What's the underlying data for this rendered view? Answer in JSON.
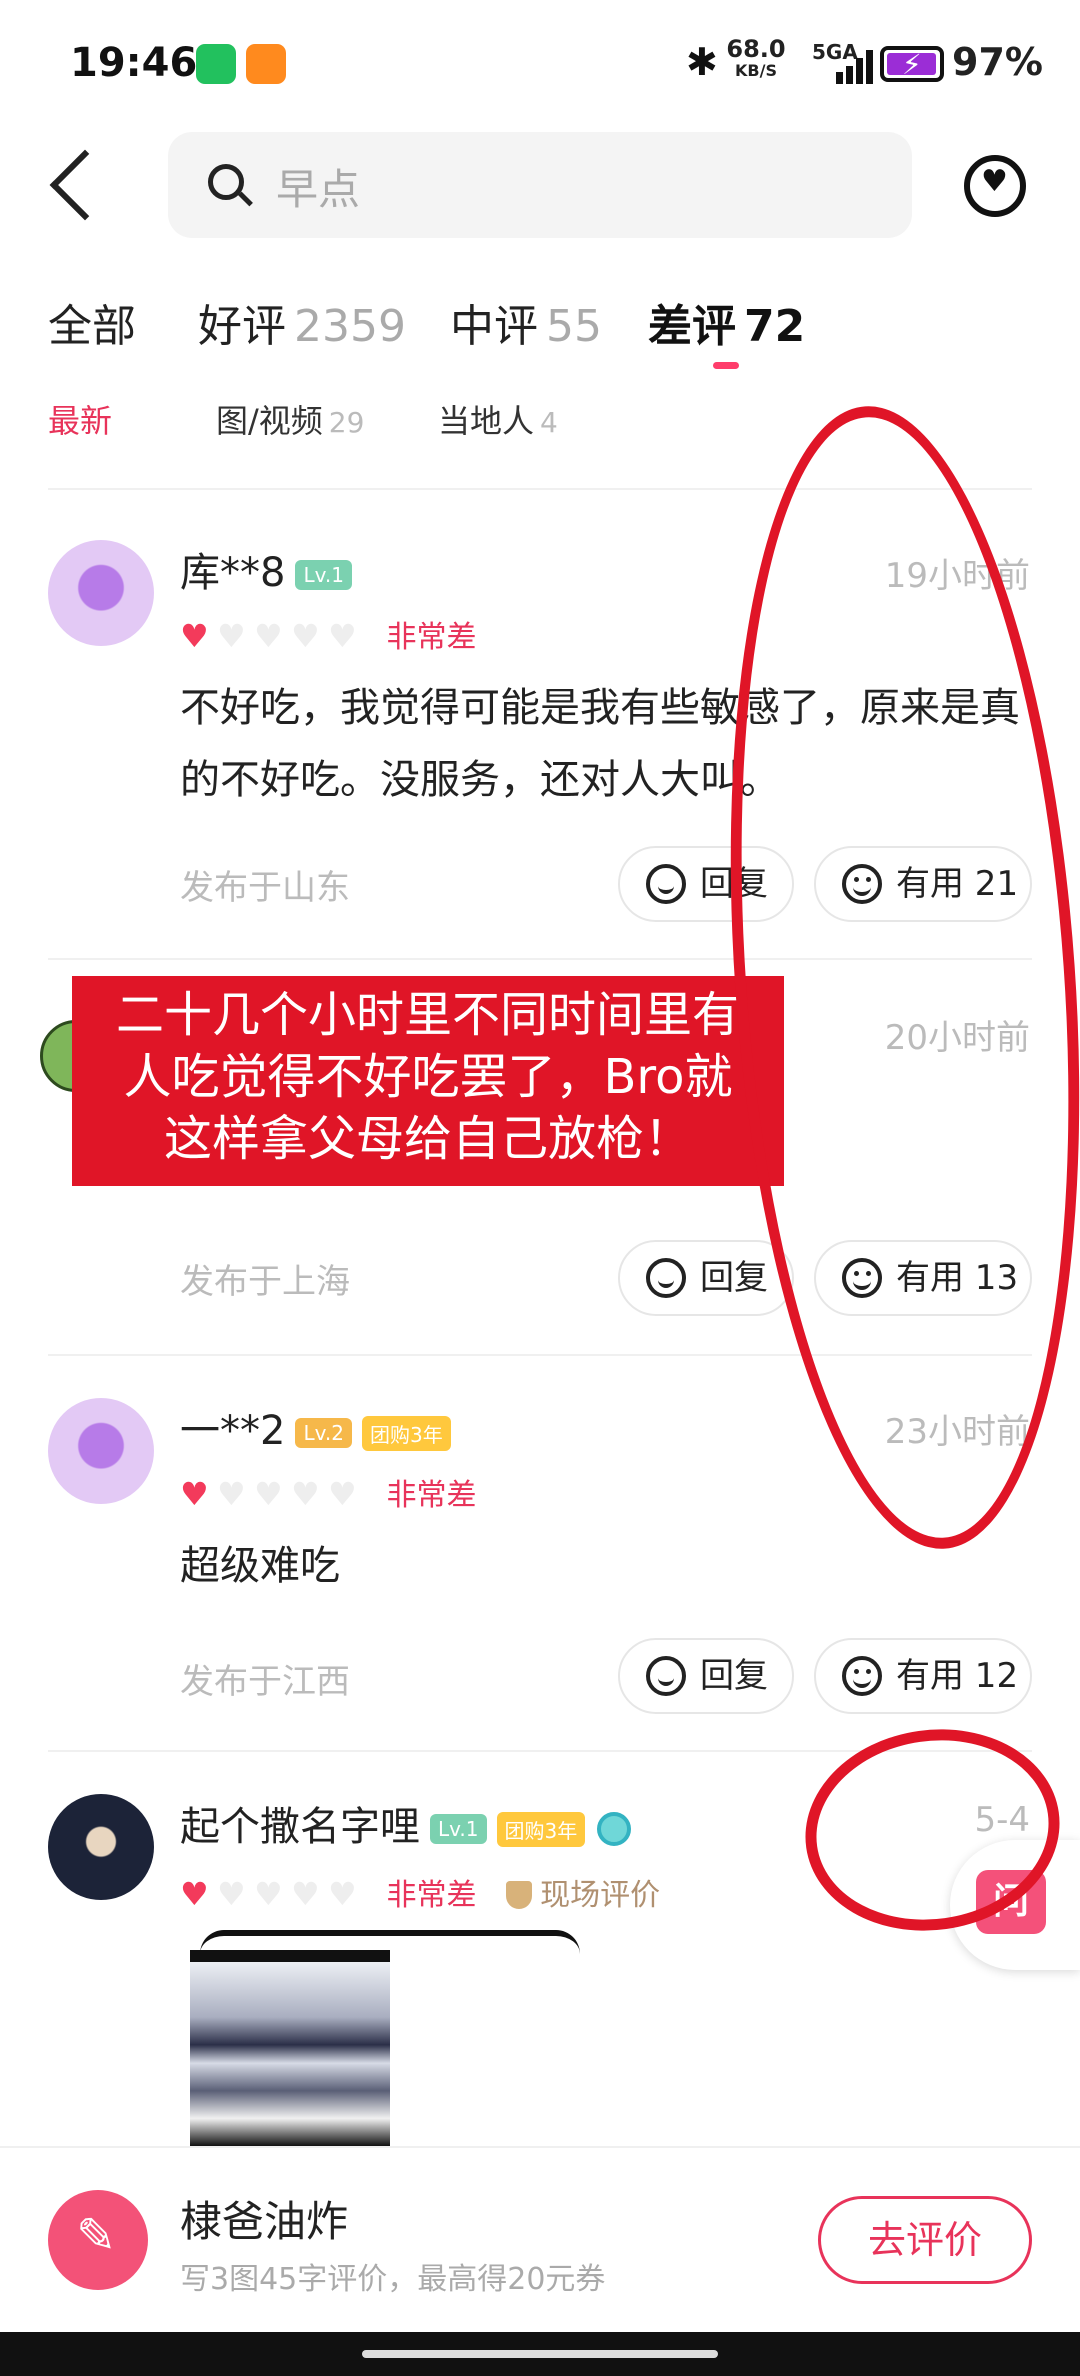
{
  "status_bar": {
    "time": "19:46",
    "speed_value": "68.0",
    "speed_unit": "KB/S",
    "network": "5GA",
    "battery": "97%",
    "battery_level": 0.97
  },
  "header": {
    "search_placeholder": "早点"
  },
  "tabs": [
    {
      "label": "全部",
      "count": ""
    },
    {
      "label": "好评",
      "count": "2359"
    },
    {
      "label": "中评",
      "count": "55"
    },
    {
      "label": "差评",
      "count": "72"
    }
  ],
  "filters": [
    {
      "label": "最新",
      "count": ""
    },
    {
      "label": "图/视频",
      "count": "29"
    },
    {
      "label": "当地人",
      "count": "4"
    }
  ],
  "reviews": [
    {
      "user": "库**8",
      "level": "Lv.1",
      "time": "19小时前",
      "rating_label": "非常差",
      "hearts": 1,
      "text": "不好吃，我觉得可能是我有些敏感了，原来是真的不好吃。没服务，还对人大叫。",
      "location": "发布于山东",
      "reply_label": "回复",
      "useful_label": "有用 21"
    },
    {
      "time": "20小时前",
      "location": "发布于上海",
      "reply_label": "回复",
      "useful_label": "有用 13"
    },
    {
      "user": "一**2",
      "level": "Lv.2",
      "group_badge": "团购3年",
      "time": "23小时前",
      "rating_label": "非常差",
      "hearts": 1,
      "text": "超级难吃",
      "location": "发布于江西",
      "reply_label": "回复",
      "useful_label": "有用 12"
    },
    {
      "user": "起个撒名字哩",
      "level": "Lv.1",
      "group_badge": "团购3年",
      "time": "5-4",
      "rating_label": "非常差",
      "hearts": 1,
      "onsite_label": "现场评价"
    }
  ],
  "overlay_caption": [
    "二十几个小时里不同时间里有",
    "人吃觉得不好吃罢了，Bro就",
    "这样拿父母给自己放枪！"
  ],
  "float_button": {
    "label": "问"
  },
  "bottom_bar": {
    "shop_name": "棣爸油炸",
    "subtitle": "写3图45字评价，最高得20元券",
    "button_label": "去评价"
  },
  "colors": {
    "accent": "#e8335a",
    "annotation_red": "#e01527"
  }
}
